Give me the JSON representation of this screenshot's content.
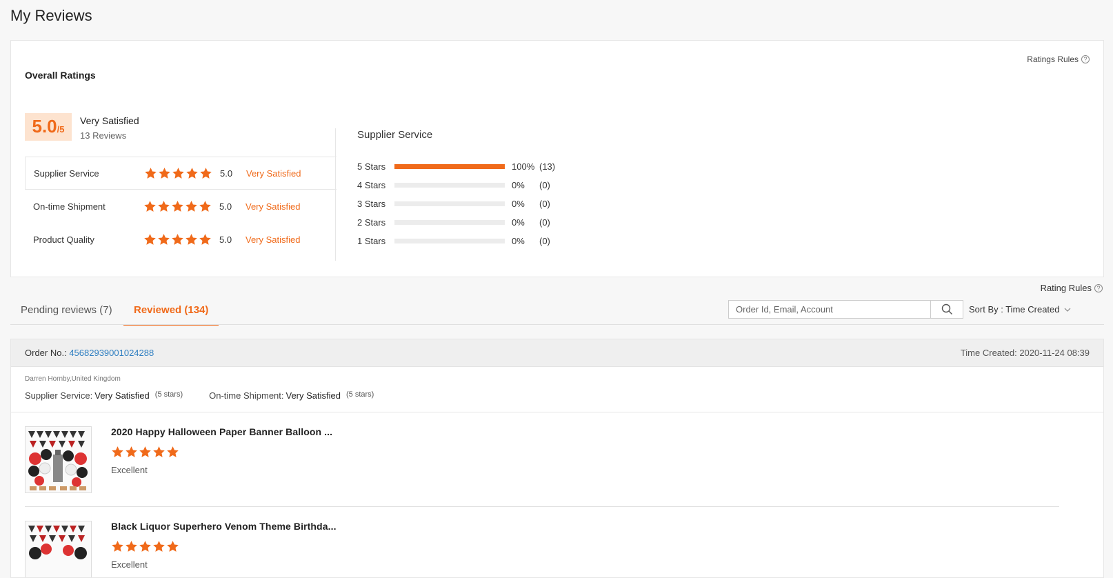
{
  "page": {
    "title": "My Reviews"
  },
  "overall": {
    "title": "Overall Ratings",
    "rules_label": "Ratings Rules",
    "score": "5.0",
    "score_den": "/5",
    "summary_label": "Very Satisfied",
    "review_count": "13 Reviews",
    "categories": [
      {
        "name": "Supplier Service",
        "stars": 5,
        "score": "5.0",
        "desc": "Very Satisfied"
      },
      {
        "name": "On-time Shipment",
        "stars": 5,
        "score": "5.0",
        "desc": "Very Satisfied"
      },
      {
        "name": "Product Quality",
        "stars": 5,
        "score": "5.0",
        "desc": "Very Satisfied"
      }
    ],
    "distribution_title": "Supplier Service",
    "distribution": [
      {
        "label": "5  Stars",
        "fraction": 1.0,
        "pct": "100%",
        "count": "(13)"
      },
      {
        "label": "4  Stars",
        "fraction": 0.0,
        "pct": "0%",
        "count": "(0)"
      },
      {
        "label": "3  Stars",
        "fraction": 0.0,
        "pct": "0%",
        "count": "(0)"
      },
      {
        "label": "2  Stars",
        "fraction": 0.0,
        "pct": "0%",
        "count": "(0)"
      },
      {
        "label": "1  Stars",
        "fraction": 0.0,
        "pct": "0%",
        "count": "(0)"
      }
    ]
  },
  "tabs": {
    "rules_label": "Rating Rules",
    "pending": "Pending reviews (7)",
    "reviewed": "Reviewed (134)"
  },
  "search": {
    "placeholder": "Order Id, Email, Account",
    "value": ""
  },
  "sort": {
    "label": "Sort By : Time Created"
  },
  "order": {
    "no_label": "Order No.:",
    "no_value": "45682939001024288",
    "time": "Time Created: 2020-11-24 08:39",
    "buyer": "Darren Hornby,United Kingdom",
    "supplier_label": "Supplier Service:",
    "supplier_value": "Very Satisfied",
    "supplier_stars": "(5 stars)",
    "shipment_label": "On-time Shipment:",
    "shipment_value": "Very Satisfied",
    "shipment_stars": "(5 stars)",
    "products": [
      {
        "title": "2020 Happy Halloween Paper Banner Balloon ...",
        "stars": 5,
        "verdict": "Excellent"
      },
      {
        "title": "Black Liquor Superhero Venom Theme Birthda...",
        "stars": 5,
        "verdict": "Excellent"
      }
    ]
  },
  "colors": {
    "accent": "#f06a1a",
    "link": "#2f7fc1"
  }
}
